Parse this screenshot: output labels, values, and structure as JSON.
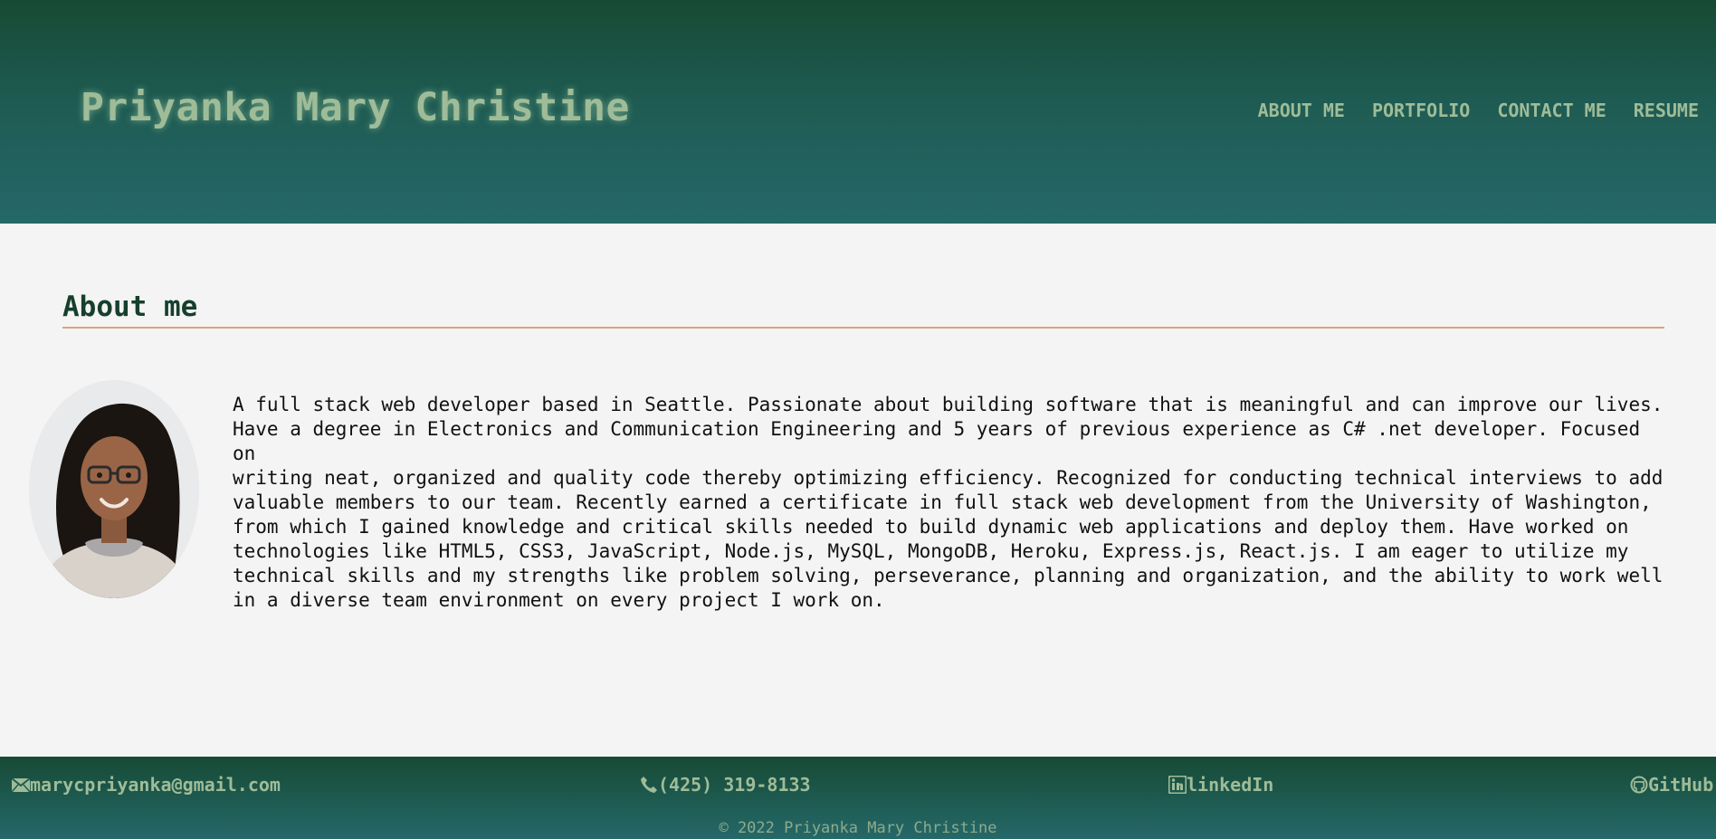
{
  "header": {
    "site_title": "Priyanka Mary Christine",
    "nav": [
      {
        "label": "ABOUT ME"
      },
      {
        "label": "PORTFOLIO"
      },
      {
        "label": "CONTACT ME"
      },
      {
        "label": "RESUME"
      }
    ]
  },
  "about": {
    "title": "About me",
    "text": "A full stack web developer based in Seattle. Passionate about building software that is meaningful and can improve our lives.\nHave a degree in Electronics and Communication Engineering and 5 years of previous experience as C# .net developer. Focused on\nwriting neat, organized and quality code thereby optimizing efficiency. Recognized for conducting technical interviews to add\nvaluable members to our team. Recently earned a certificate in full stack web development from the University of Washington,\nfrom which I gained knowledge and critical skills needed to build dynamic web applications and deploy them. Have worked on\ntechnologies like HTML5, CSS3, JavaScript, Node.js, MySQL, MongoDB, Heroku, Express.js, React.js. I am eager to utilize my\ntechnical skills and my strengths like problem solving, perseverance, planning and organization, and the ability to work well\nin a diverse team environment on every project I work on."
  },
  "footer": {
    "email": {
      "label": "marycpriyanka@gmail.com",
      "icon": "envelope-icon"
    },
    "phone": {
      "label": "(425) 319-8133",
      "icon": "phone-icon"
    },
    "linkedin": {
      "label": "linkedIn",
      "icon": "linkedin-icon"
    },
    "github": {
      "label": "GitHub",
      "icon": "github-icon"
    },
    "copyright": "© 2022 Priyanka Mary Christine"
  },
  "colors": {
    "header_dark": "#174a34",
    "header_light": "#256869",
    "accent_text": "#9fbc98",
    "heading": "#163f2c",
    "rule": "#d9a382",
    "background": "#f4f4f4"
  }
}
